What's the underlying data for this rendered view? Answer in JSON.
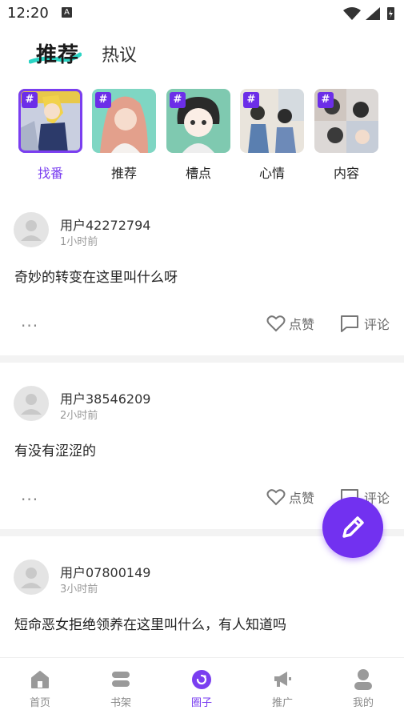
{
  "status_bar": {
    "time": "12:20",
    "notification_letter": "A"
  },
  "header": {
    "tabs": [
      {
        "label": "推荐",
        "active": true
      },
      {
        "label": "热议",
        "active": false
      }
    ]
  },
  "categories": [
    {
      "label": "找番",
      "selected": true
    },
    {
      "label": "推荐",
      "selected": false
    },
    {
      "label": "槽点",
      "selected": false
    },
    {
      "label": "心情",
      "selected": false
    },
    {
      "label": "内容",
      "selected": false
    }
  ],
  "category_badge": "#",
  "posts": [
    {
      "username": "用户42272794",
      "time": "1小时前",
      "content": "奇妙的转变在这里叫什么呀",
      "like_label": "点赞",
      "comment_label": "评论"
    },
    {
      "username": "用户38546209",
      "time": "2小时前",
      "content": "有没有涩涩的",
      "like_label": "点赞",
      "comment_label": "评论"
    },
    {
      "username": "用户07800149",
      "time": "3小时前",
      "content": "短命恶女拒绝领养在这里叫什么，有人知道吗"
    }
  ],
  "more_label": "···",
  "bottom_nav": [
    {
      "label": "首页",
      "icon": "home-icon",
      "active": false
    },
    {
      "label": "书架",
      "icon": "bookshelf-icon",
      "active": false
    },
    {
      "label": "圈子",
      "icon": "circle-icon",
      "active": true
    },
    {
      "label": "推广",
      "icon": "megaphone-icon",
      "active": false
    },
    {
      "label": "我的",
      "icon": "profile-icon",
      "active": false
    }
  ],
  "colors": {
    "accent": "#7231f0",
    "accent_text": "#7a3ef0",
    "divider": "#f3f3f3"
  }
}
